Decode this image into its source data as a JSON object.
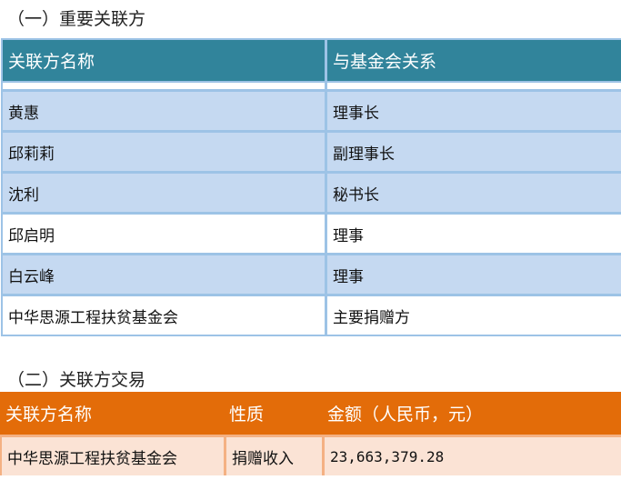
{
  "section1": {
    "title": "（一）重要关联方",
    "headers": [
      "关联方名称",
      "与基金会关系"
    ],
    "rows": [
      {
        "name": "黄惠",
        "relation": "理事长"
      },
      {
        "name": "邱莉莉",
        "relation": "副理事长"
      },
      {
        "name": "沈利",
        "relation": "秘书长"
      },
      {
        "name": "邱启明",
        "relation": "理事"
      },
      {
        "name": "白云峰",
        "relation": "理事"
      },
      {
        "name": "中华思源工程扶贫基金会",
        "relation": "主要捐赠方"
      }
    ]
  },
  "section2": {
    "title": "（二）关联方交易",
    "headers": [
      "关联方名称",
      "性质",
      "金额（人民币，元）"
    ],
    "rows": [
      {
        "name": "中华思源工程扶贫基金会",
        "nature": "捐赠收入",
        "amount": "23,663,379.28"
      }
    ]
  },
  "colors": {
    "section1_header": "#31849b",
    "section1_shade": "#c5d9f1",
    "section1_border": "#9dc3e6",
    "section2_header": "#e36c09",
    "section2_row": "#fbe3d5"
  }
}
